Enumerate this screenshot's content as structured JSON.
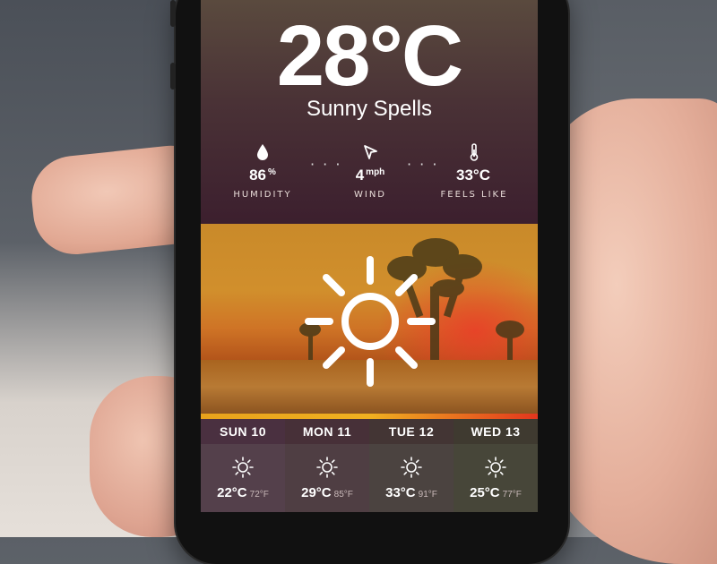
{
  "current": {
    "temperature": "28°C",
    "condition": "Sunny Spells",
    "condition_icon": "sun-icon"
  },
  "stats": [
    {
      "icon": "water-drop-icon",
      "value": "86",
      "unit": "%",
      "label": "HUMIDITY"
    },
    {
      "icon": "location-arrow-icon",
      "value": "4",
      "unit": "mph",
      "label": "WIND"
    },
    {
      "icon": "thermometer-icon",
      "value": "33°C",
      "unit": "",
      "label": "FEELS LIKE"
    }
  ],
  "separator": "· · ·",
  "forecast": [
    {
      "day": "SUN 10",
      "temp_c": "22°C",
      "temp_f": "72°F",
      "icon": "sun-icon"
    },
    {
      "day": "MON 11",
      "temp_c": "29°C",
      "temp_f": "85°F",
      "icon": "sun-icon"
    },
    {
      "day": "TUE 12",
      "temp_c": "33°C",
      "temp_f": "91°F",
      "icon": "sun-icon"
    },
    {
      "day": "WED 13",
      "temp_c": "25°C",
      "temp_f": "77°F",
      "icon": "sun-icon"
    }
  ],
  "colors": {
    "accent_orange": "#f0b020",
    "accent_red": "#e2361e",
    "panel_dark": "#3c1f2e"
  }
}
